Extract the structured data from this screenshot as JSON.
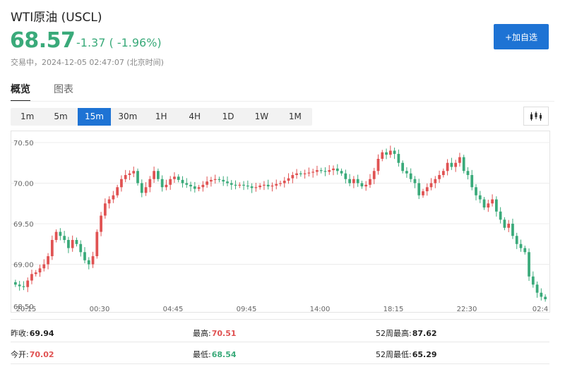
{
  "header": {
    "title": "WTI原油 (USCL)",
    "price": "68.57",
    "change": "-1.37 ( -1.96%)",
    "status": "交易中，2024-12-05 02:47:07 (北京时间)",
    "add_button": "+加自选"
  },
  "tabs": [
    {
      "label": "概览",
      "active": true
    },
    {
      "label": "图表",
      "active": false
    }
  ],
  "periods": [
    {
      "label": "1m",
      "active": false
    },
    {
      "label": "5m",
      "active": false
    },
    {
      "label": "15m",
      "active": true
    },
    {
      "label": "30m",
      "active": false
    },
    {
      "label": "1H",
      "active": false
    },
    {
      "label": "4H",
      "active": false
    },
    {
      "label": "1D",
      "active": false
    },
    {
      "label": "1W",
      "active": false
    },
    {
      "label": "1M",
      "active": false
    }
  ],
  "chart_type_icon": "candlestick-icon",
  "colors": {
    "up": "#e05252",
    "down": "#3aaa7a",
    "accent": "#1e73d4",
    "grid": "#ececec"
  },
  "chart_data": {
    "type": "candlestick",
    "y_ticks": [
      "70.50",
      "70.00",
      "69.50",
      "69.00",
      "68.50"
    ],
    "ylim": [
      68.5,
      70.5
    ],
    "x_ticks": [
      "20:15",
      "00:30",
      "04:45",
      "09:45",
      "14:00",
      "18:15",
      "22:30",
      "02:4"
    ],
    "grid": true,
    "close_series": [
      68.75,
      68.73,
      68.72,
      68.8,
      68.88,
      68.9,
      68.95,
      69.0,
      69.1,
      69.3,
      69.4,
      69.35,
      69.3,
      69.2,
      69.3,
      69.25,
      69.15,
      69.05,
      69.0,
      69.1,
      69.4,
      69.6,
      69.75,
      69.8,
      69.85,
      69.95,
      70.05,
      70.1,
      70.12,
      70.15,
      70.0,
      69.88,
      69.95,
      70.05,
      70.15,
      70.05,
      69.95,
      69.98,
      70.05,
      70.08,
      70.04,
      70.0,
      69.98,
      69.96,
      69.93,
      69.95,
      69.98,
      70.02,
      70.04,
      70.05,
      70.04,
      70.02,
      70.0,
      69.98,
      69.97,
      69.98,
      69.97,
      69.96,
      69.94,
      69.95,
      69.97,
      69.98,
      69.96,
      69.97,
      69.99,
      70.0,
      70.03,
      70.06,
      70.1,
      70.12,
      70.11,
      70.12,
      70.13,
      70.14,
      70.16,
      70.15,
      70.14,
      70.16,
      70.18,
      70.15,
      70.12,
      70.05,
      70.0,
      70.05,
      70.0,
      69.96,
      69.98,
      70.05,
      70.15,
      70.3,
      70.38,
      70.35,
      70.4,
      70.36,
      70.25,
      70.15,
      70.12,
      70.05,
      70.0,
      69.85,
      69.9,
      69.95,
      70.0,
      70.05,
      70.1,
      70.15,
      70.25,
      70.2,
      70.25,
      70.32,
      70.15,
      70.1,
      69.95,
      69.85,
      69.8,
      69.7,
      69.75,
      69.8,
      69.65,
      69.55,
      69.45,
      69.5,
      69.35,
      69.25,
      69.2,
      69.15,
      68.85,
      68.75,
      68.65,
      68.6,
      68.57
    ],
    "high": "70.51",
    "low": "68.54"
  },
  "stats": {
    "prev_close_label": "昨收:",
    "prev_close": "69.94",
    "open_label": "今开:",
    "open": "70.02",
    "high_label": "最高:",
    "high": "70.51",
    "low_label": "最低:",
    "low": "68.54",
    "w52_high_label": "52周最高:",
    "w52_high": "87.62",
    "w52_low_label": "52周最低:",
    "w52_low": "65.29"
  }
}
